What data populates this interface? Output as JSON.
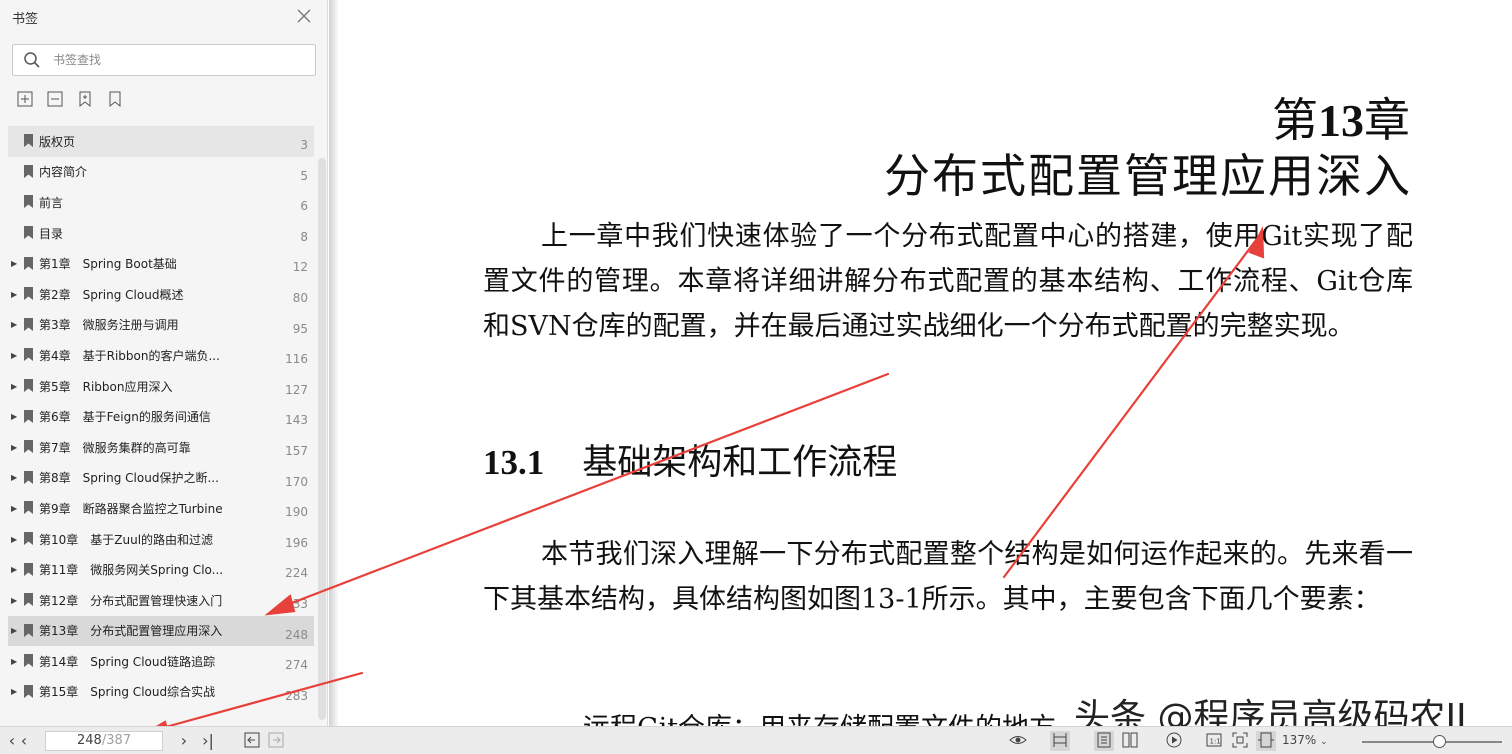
{
  "sidebar": {
    "title": "书签",
    "search_placeholder": "书签查找",
    "bookmarks": [
      {
        "label": "版权页",
        "page": "3",
        "expandable": false
      },
      {
        "label": "内容简介",
        "page": "5",
        "expandable": false
      },
      {
        "label": "前言",
        "page": "6",
        "expandable": false
      },
      {
        "label": "目录",
        "page": "8",
        "expandable": false
      },
      {
        "label": "第1章　Spring Boot基础",
        "page": "12",
        "expandable": true
      },
      {
        "label": "第2章　Spring Cloud概述",
        "page": "80",
        "expandable": true
      },
      {
        "label": "第3章　微服务注册与调用",
        "page": "95",
        "expandable": true
      },
      {
        "label": "第4章　基于Ribbon的客户端负...",
        "page": "116",
        "expandable": true
      },
      {
        "label": "第5章　Ribbon应用深入",
        "page": "127",
        "expandable": true
      },
      {
        "label": "第6章　基于Feign的服务间通信",
        "page": "143",
        "expandable": true
      },
      {
        "label": "第7章　微服务集群的高可靠",
        "page": "157",
        "expandable": true
      },
      {
        "label": "第8章　Spring Cloud保护之断...",
        "page": "170",
        "expandable": true
      },
      {
        "label": "第9章　断路器聚合监控之Turbine",
        "page": "190",
        "expandable": true
      },
      {
        "label": "第10章　基于Zuul的路由和过滤",
        "page": "196",
        "expandable": true
      },
      {
        "label": "第11章　微服务网关Spring Clo...",
        "page": "224",
        "expandable": true
      },
      {
        "label": "第12章　分布式配置管理快速入门",
        "page": "233",
        "expandable": true
      },
      {
        "label": "第13章　分布式配置管理应用深入",
        "page": "248",
        "expandable": true
      },
      {
        "label": "第14章　Spring Cloud链路追踪",
        "page": "274",
        "expandable": true
      },
      {
        "label": "第15章　Spring Cloud综合实战",
        "page": "283",
        "expandable": true
      }
    ]
  },
  "document": {
    "chapter_prefix": "第",
    "chapter_number": "13",
    "chapter_suffix": "章",
    "chapter_title": "分布式配置管理应用深入",
    "paragraph1": "上一章中我们快速体验了一个分布式配置中心的搭建，使用Git实现了配置文件的管理。本章将详细讲解分布式配置的基本结构、工作流程、Git仓库和SVN仓库的配置，并在最后通过实战细化一个分布式配置的完整实现。",
    "section_number": "13.1",
    "section_title": "基础架构和工作流程",
    "paragraph2": "本节我们深入理解一下分布式配置整个结构是如何运作起来的。先来看一下其基本结构，具体结构图如图13-1所示。其中，主要包含下面几个要素：",
    "cut_off_line": "远程Git仓库：用来存储配置文件的地方",
    "watermark": "头条 @程序员高级码农II"
  },
  "statusbar": {
    "current_page": "248",
    "total_pages": "/387",
    "zoom": "137%"
  },
  "colors": {
    "annotation_arrow": "#e8403a",
    "sidebar_bg": "#f5f5f5",
    "selected_row": "#d9d9d9"
  }
}
